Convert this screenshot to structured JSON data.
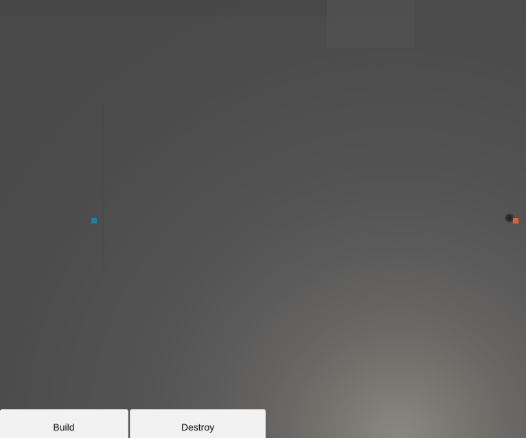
{
  "toolbar": {
    "build_label": "Build",
    "destroy_label": "Destroy"
  },
  "markers": {
    "left_color": "#1e7fa0",
    "right_color": "#e0622a"
  },
  "colors": {
    "background": "#4b4b4b",
    "glow_center": "#8a8782",
    "button_bg": "#f2f2f2"
  }
}
